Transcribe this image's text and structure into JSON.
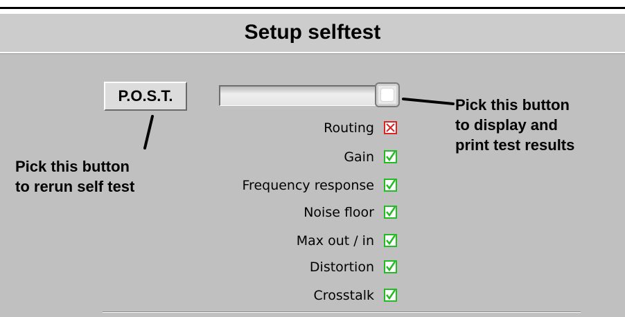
{
  "window": {
    "title": "Setup selftest"
  },
  "buttons": {
    "post_label": "P.O.S.T."
  },
  "tests": [
    {
      "label": "Routing",
      "status": "fail",
      "icon": "fail-x-icon"
    },
    {
      "label": "Gain",
      "status": "pass",
      "icon": "pass-check-icon"
    },
    {
      "label": "Frequency response",
      "status": "pass",
      "icon": "pass-check-icon"
    },
    {
      "label": "Noise floor",
      "status": "pass",
      "icon": "pass-check-icon"
    },
    {
      "label": "Max out / in",
      "status": "pass",
      "icon": "pass-check-icon"
    },
    {
      "label": "Distortion",
      "status": "pass",
      "icon": "pass-check-icon"
    },
    {
      "label": "Crosstalk",
      "status": "pass",
      "icon": "pass-check-icon"
    }
  ],
  "annotations": {
    "rerun": [
      "Pick this button",
      "to rerun self test"
    ],
    "results": [
      "Pick this button",
      "to display and",
      "print test results"
    ]
  },
  "colors": {
    "pass": "#22bb22",
    "fail": "#dd2222",
    "panel": "#c0c0c0"
  }
}
